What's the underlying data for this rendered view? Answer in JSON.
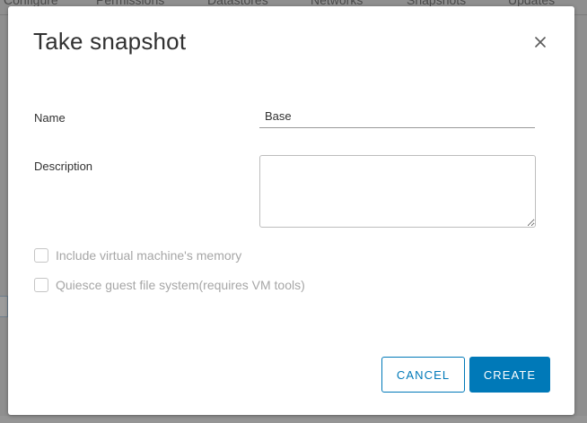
{
  "background": {
    "tabs": [
      "Configure",
      "Permissions",
      "Datastores",
      "Networks",
      "Snapshots",
      "Updates"
    ]
  },
  "dialog": {
    "title": "Take snapshot",
    "close_icon": "close-icon",
    "name_label": "Name",
    "name_value": "Base",
    "description_label": "Description",
    "description_value": "",
    "memory_label": "Include virtual machine's memory",
    "quiesce_label": "Quiesce guest file system(requires VM tools)",
    "cancel_label": "CANCEL",
    "create_label": "CREATE"
  },
  "colors": {
    "primary": "#0079b8",
    "text": "#313131",
    "disabled_text": "#a6a6a6",
    "overlay": "#8f8f8f"
  }
}
